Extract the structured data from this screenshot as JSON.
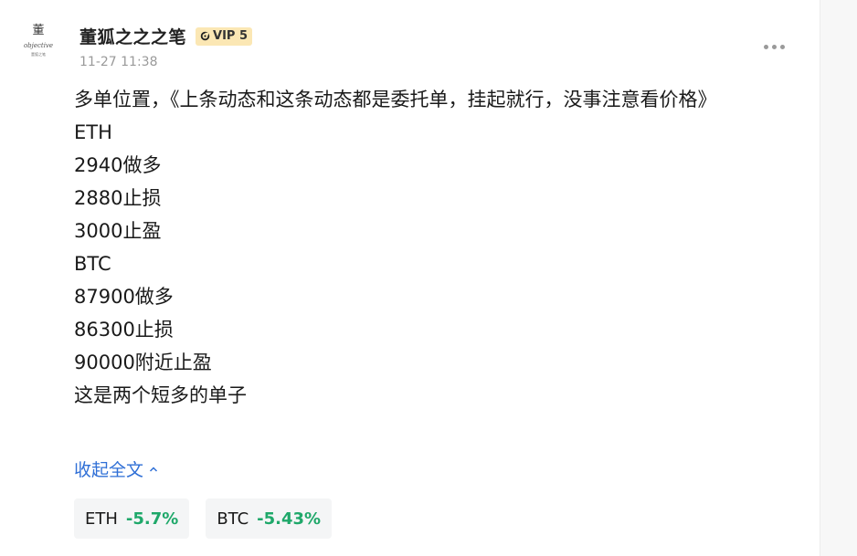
{
  "author": {
    "name": "董狐之之之笔",
    "vip": "VIP 5",
    "avatar_logo": {
      "mark": "董",
      "script": "objective",
      "small": "董狐之笔"
    }
  },
  "timestamp": "11-27 11:38",
  "content_lines": [
    "多单位置，《上条动态和这条动态都是委托单，挂起就行，没事注意看价格》",
    "ETH",
    "2940做多",
    "2880止损",
    "3000止盈",
    "BTC",
    "87900做多",
    "86300止损",
    "90000附近止盈",
    "这是两个短多的单子"
  ],
  "collapse_label": "收起全文",
  "tags": [
    {
      "symbol": "ETH",
      "change": "-5.7%"
    },
    {
      "symbol": "BTC",
      "change": "-5.43%"
    }
  ],
  "colors": {
    "link": "#2f6fd6",
    "change": "#1fa86a",
    "vip_bg": "#fbe7b4"
  },
  "icons": {
    "more": "more-dots-icon",
    "chevron": "chevron-up-icon",
    "vip": "vip-ring-icon"
  }
}
